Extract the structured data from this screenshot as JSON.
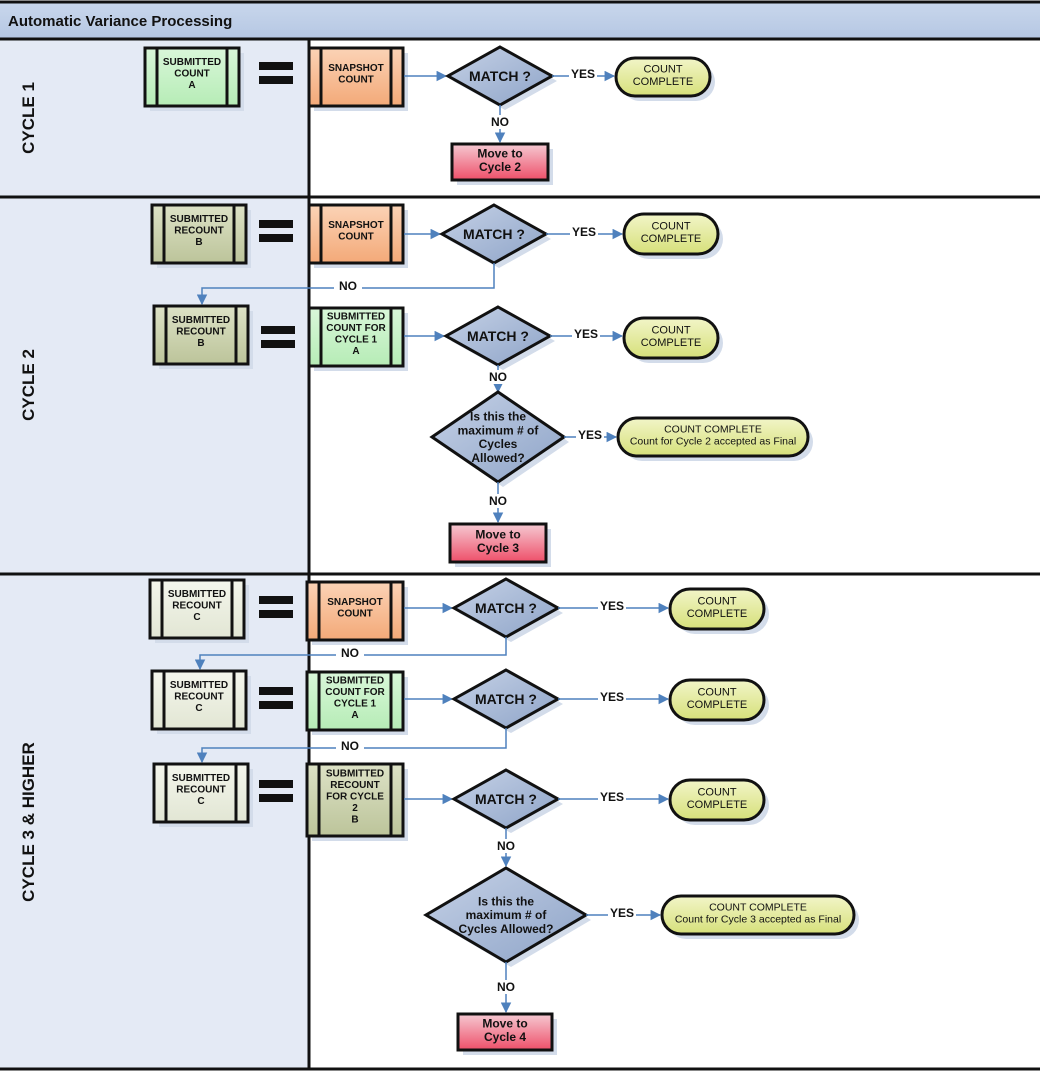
{
  "title": "Automatic Variance Processing",
  "colors": {
    "header_bg": "#c5d4ea",
    "lane_left_bg": "#e4eaf5",
    "green_box": "#c8f2c8",
    "olive_box": "#cdd4b0",
    "cream_box": "#ecefe2",
    "orange_box": "#f6b990",
    "diamond": "#a9bad6",
    "terminal": "#dfe88a",
    "move_box": "#f06a80",
    "arrow": "#4f81bd"
  },
  "lanes": [
    {
      "label": "CYCLE 1",
      "steps": [
        {
          "left": "SUBMITTED\nCOUNT\nA",
          "right": "SNAPSHOT\nCOUNT",
          "decision": "MATCH ?",
          "yes": "YES",
          "result": "COUNT\nCOMPLETE"
        }
      ],
      "no_label": "NO",
      "move": "Move to\nCycle 2"
    },
    {
      "label": "CYCLE 2",
      "steps": [
        {
          "left": "SUBMITTED\nRECOUNT\nB",
          "right": "SNAPSHOT\nCOUNT",
          "decision": "MATCH ?",
          "yes": "YES",
          "result": "COUNT\nCOMPLETE",
          "no": "NO"
        },
        {
          "left": "SUBMITTED\nRECOUNT\nB",
          "right": "SUBMITTED\nCOUNT FOR\nCYCLE 1\nA",
          "decision": "MATCH ?",
          "yes": "YES",
          "result": "COUNT\nCOMPLETE",
          "no": "NO"
        }
      ],
      "max_decision": "Is this the\nmaximum # of\nCycles\nAllowed?",
      "max_yes": "YES",
      "max_result": "COUNT COMPLETE\nCount for Cycle 2 accepted as Final",
      "no_label": "NO",
      "move": "Move to\nCycle 3"
    },
    {
      "label": "CYCLE 3 & HIGHER",
      "steps": [
        {
          "left": "SUBMITTED\nRECOUNT\nC",
          "right": "SNAPSHOT\nCOUNT",
          "decision": "MATCH ?",
          "yes": "YES",
          "result": "COUNT\nCOMPLETE",
          "no": "NO"
        },
        {
          "left": "SUBMITTED\nRECOUNT\nC",
          "right": "SUBMITTED\nCOUNT FOR\nCYCLE 1\nA",
          "decision": "MATCH ?",
          "yes": "YES",
          "result": "COUNT\nCOMPLETE",
          "no": "NO"
        },
        {
          "left": "SUBMITTED\nRECOUNT\nC",
          "right": "SUBMITTED\nRECOUNT\nFOR CYCLE\n2\nB",
          "decision": "MATCH ?",
          "yes": "YES",
          "result": "COUNT\nCOMPLETE",
          "no": "NO"
        }
      ],
      "max_decision": "Is this the\nmaximum # of\nCycles Allowed?",
      "max_yes": "YES",
      "max_result": "COUNT COMPLETE\nCount for Cycle 3 accepted as Final",
      "no_label": "NO",
      "move": "Move to\nCycle 4"
    }
  ]
}
